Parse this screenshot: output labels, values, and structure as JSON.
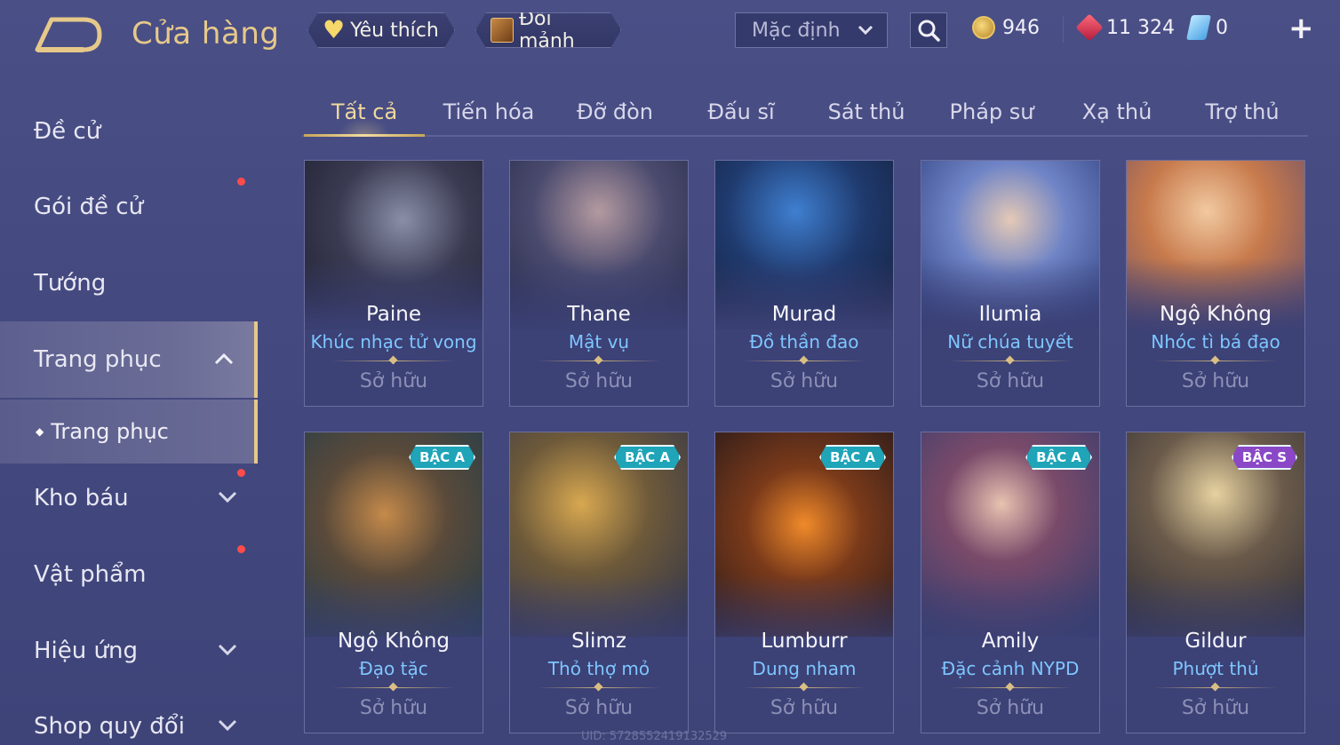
{
  "header": {
    "title": "Cửa hàng",
    "favorites_label": "Yêu thích",
    "exchange_label": "Đổi mảnh",
    "sort_selected": "Mặc định",
    "currency_gold": "946",
    "currency_gem": "11 324",
    "currency_voucher": "0"
  },
  "sidebar": {
    "items": [
      {
        "label": "Đề cử"
      },
      {
        "label": "Gói đề cử"
      },
      {
        "label": "Tướng"
      },
      {
        "label": "Trang phục"
      },
      {
        "label": "Kho báu"
      },
      {
        "label": "Vật phẩm"
      },
      {
        "label": "Hiệu ứng"
      },
      {
        "label": "Shop quy đổi"
      }
    ],
    "sub_item": "Trang phục"
  },
  "tabs": [
    "Tất cả",
    "Tiến hóa",
    "Đỡ đòn",
    "Đấu sĩ",
    "Sát thủ",
    "Pháp sư",
    "Xạ thủ",
    "Trợ thủ"
  ],
  "cards": [
    {
      "hero": "Paine",
      "skin": "Khúc nhạc tử vong",
      "status": "Sở hữu"
    },
    {
      "hero": "Thane",
      "skin": "Mật vụ",
      "status": "Sở hữu"
    },
    {
      "hero": "Murad",
      "skin": "Đồ thần đao",
      "status": "Sở hữu"
    },
    {
      "hero": "Ilumia",
      "skin": "Nữ chúa tuyết",
      "status": "Sở hữu"
    },
    {
      "hero": "Ngộ Không",
      "skin": "Nhóc tì bá đạo",
      "status": "Sở hữu"
    },
    {
      "hero": "Ngộ Không",
      "skin": "Đạo tặc",
      "status": "Sở hữu",
      "rank": "BẬC A"
    },
    {
      "hero": "Slimz",
      "skin": "Thỏ thợ mỏ",
      "status": "Sở hữu",
      "rank": "BẬC A"
    },
    {
      "hero": "Lumburr",
      "skin": "Dung nham",
      "status": "Sở hữu",
      "rank": "BẬC A"
    },
    {
      "hero": "Amily",
      "skin": "Đặc cảnh NYPD",
      "status": "Sở hữu",
      "rank": "BẬC A"
    },
    {
      "hero": "Gildur",
      "skin": "Phượt thủ",
      "status": "Sở hữu",
      "rank": "BẬC S"
    }
  ],
  "uid": "UID: 5728552419132529",
  "colors": {
    "accent_gold": "#e6c98a",
    "skin_name_blue": "#7ec6ff",
    "rank_a": "#1fa4b8",
    "rank_s": "#8a48c6",
    "notification_red": "#ff4b4b"
  },
  "icons": {
    "back": "back-arrow-icon",
    "favorite": "heart-icon",
    "exchange": "shard-box-icon",
    "search": "search-icon",
    "gold": "gold-coin-icon",
    "gem": "red-gem-icon",
    "voucher": "voucher-icon",
    "add": "plus-icon"
  }
}
